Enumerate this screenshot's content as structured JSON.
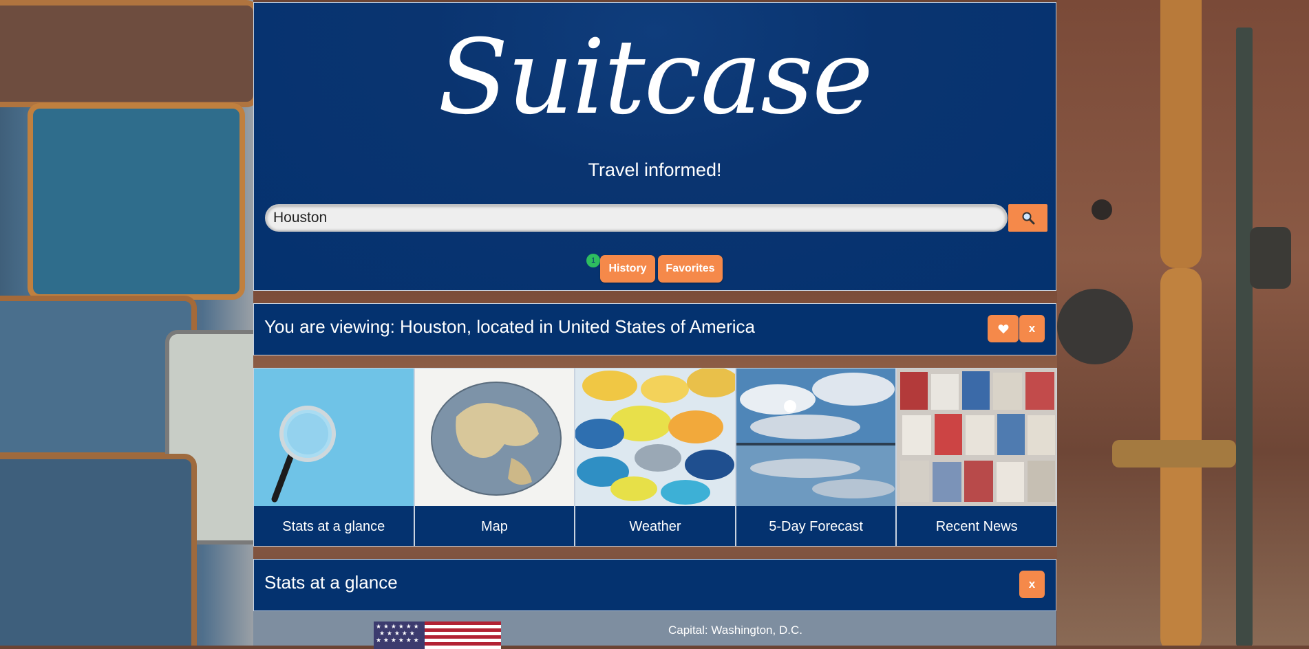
{
  "header": {
    "logo": "Suitcase",
    "tagline": "Travel informed!"
  },
  "search": {
    "value": "Houston",
    "button_icon": "search-icon"
  },
  "nav": {
    "history_count": "1",
    "history_label": "History",
    "favorites_label": "Favorites"
  },
  "viewing": {
    "text": "You are viewing: Houston, located in United States of America",
    "favorite_icon": "heart-icon",
    "close_label": "x"
  },
  "tiles": [
    {
      "label": "Stats at a glance",
      "image": "magnifying-glass-image"
    },
    {
      "label": "Map",
      "image": "globe-image"
    },
    {
      "label": "Weather",
      "image": "umbrellas-image"
    },
    {
      "label": "5-Day Forecast",
      "image": "sky-clouds-image"
    },
    {
      "label": "Recent News",
      "image": "newspapers-image"
    }
  ],
  "stats": {
    "title": "Stats at a glance",
    "close_label": "x",
    "capital": "Capital: Washington, D.C.",
    "flag": "us-flag"
  },
  "colors": {
    "navy": "#04326f",
    "accent": "#f5894a",
    "badge": "#2ebd5f"
  }
}
